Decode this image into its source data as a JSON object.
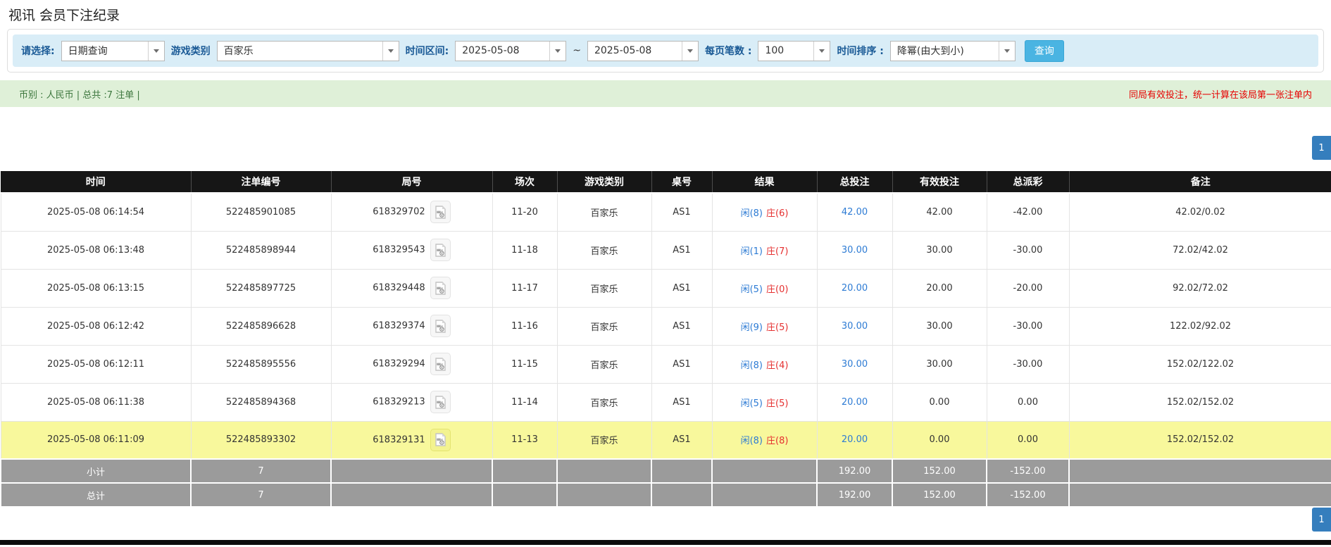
{
  "page": {
    "title": "视讯 会员下注纪录"
  },
  "filters": {
    "select_label": "请选择:",
    "select_value": "日期查询",
    "game_label": "游戏类别",
    "game_value": "百家乐",
    "range_label": "时间区间:",
    "date_from": "2025-05-08",
    "tilde": "~",
    "date_to": "2025-05-08",
    "page_size_label": "每页笔数 :",
    "page_size_value": "100",
    "sort_label": "时间排序 :",
    "sort_value": "降幂(由大到小)",
    "search_button": "查询"
  },
  "summary": {
    "left": "币别 : 人民币 | 总共 :7 注单 |",
    "right": "同局有效投注，统一计算在该局第一张注单内"
  },
  "pagination": {
    "page": "1"
  },
  "table": {
    "headers": [
      "时间",
      "注单编号",
      "局号",
      "场次",
      "游戏类别",
      "桌号",
      "结果",
      "总投注",
      "有效投注",
      "总派彩",
      "备注"
    ],
    "rows": [
      {
        "time": "2025-05-08 06:14:54",
        "bet_id": "522485901085",
        "round": "618329702",
        "session": "11-20",
        "game": "百家乐",
        "table_no": "AS1",
        "result_player": "闲(8)",
        "result_banker": "庄(6)",
        "total_bet": "42.00",
        "valid_bet": "42.00",
        "payout": "-42.00",
        "remark": "42.02/0.02",
        "highlight": false
      },
      {
        "time": "2025-05-08 06:13:48",
        "bet_id": "522485898944",
        "round": "618329543",
        "session": "11-18",
        "game": "百家乐",
        "table_no": "AS1",
        "result_player": "闲(1)",
        "result_banker": "庄(7)",
        "total_bet": "30.00",
        "valid_bet": "30.00",
        "payout": "-30.00",
        "remark": "72.02/42.02",
        "highlight": false
      },
      {
        "time": "2025-05-08 06:13:15",
        "bet_id": "522485897725",
        "round": "618329448",
        "session": "11-17",
        "game": "百家乐",
        "table_no": "AS1",
        "result_player": "闲(5)",
        "result_banker": "庄(0)",
        "total_bet": "20.00",
        "valid_bet": "20.00",
        "payout": "-20.00",
        "remark": "92.02/72.02",
        "highlight": false
      },
      {
        "time": "2025-05-08 06:12:42",
        "bet_id": "522485896628",
        "round": "618329374",
        "session": "11-16",
        "game": "百家乐",
        "table_no": "AS1",
        "result_player": "闲(9)",
        "result_banker": "庄(5)",
        "total_bet": "30.00",
        "valid_bet": "30.00",
        "payout": "-30.00",
        "remark": "122.02/92.02",
        "highlight": false
      },
      {
        "time": "2025-05-08 06:12:11",
        "bet_id": "522485895556",
        "round": "618329294",
        "session": "11-15",
        "game": "百家乐",
        "table_no": "AS1",
        "result_player": "闲(8)",
        "result_banker": "庄(4)",
        "total_bet": "30.00",
        "valid_bet": "30.00",
        "payout": "-30.00",
        "remark": "152.02/122.02",
        "highlight": false
      },
      {
        "time": "2025-05-08 06:11:38",
        "bet_id": "522485894368",
        "round": "618329213",
        "session": "11-14",
        "game": "百家乐",
        "table_no": "AS1",
        "result_player": "闲(5)",
        "result_banker": "庄(5)",
        "total_bet": "20.00",
        "valid_bet": "0.00",
        "payout": "0.00",
        "remark": "152.02/152.02",
        "highlight": false
      },
      {
        "time": "2025-05-08 06:11:09",
        "bet_id": "522485893302",
        "round": "618329131",
        "session": "11-13",
        "game": "百家乐",
        "table_no": "AS1",
        "result_player": "闲(8)",
        "result_banker": "庄(8)",
        "total_bet": "20.00",
        "valid_bet": "0.00",
        "payout": "0.00",
        "remark": "152.02/152.02",
        "highlight": true
      }
    ],
    "subtotal": {
      "label": "小计",
      "count": "7",
      "total_bet": "192.00",
      "valid_bet": "152.00",
      "payout": "-152.00"
    },
    "total": {
      "label": "总计",
      "count": "7",
      "total_bet": "192.00",
      "valid_bet": "152.00",
      "payout": "-152.00"
    }
  },
  "colors": {
    "filter_bar_bg": "#d9edf7",
    "summary_bg": "#dff0d8",
    "summary_text": "#3c763d",
    "alert_red": "#e60000",
    "header_bg": "#161616",
    "player_blue": "#2d7bd4",
    "banker_red": "#e53030",
    "negative_red": "#fe0000",
    "highlight_yellow": "#f8f89c",
    "subtotal_gray": "#9b9b9b",
    "pagination_blue": "#357ebd",
    "search_button_bg": "#4ab4e2"
  }
}
